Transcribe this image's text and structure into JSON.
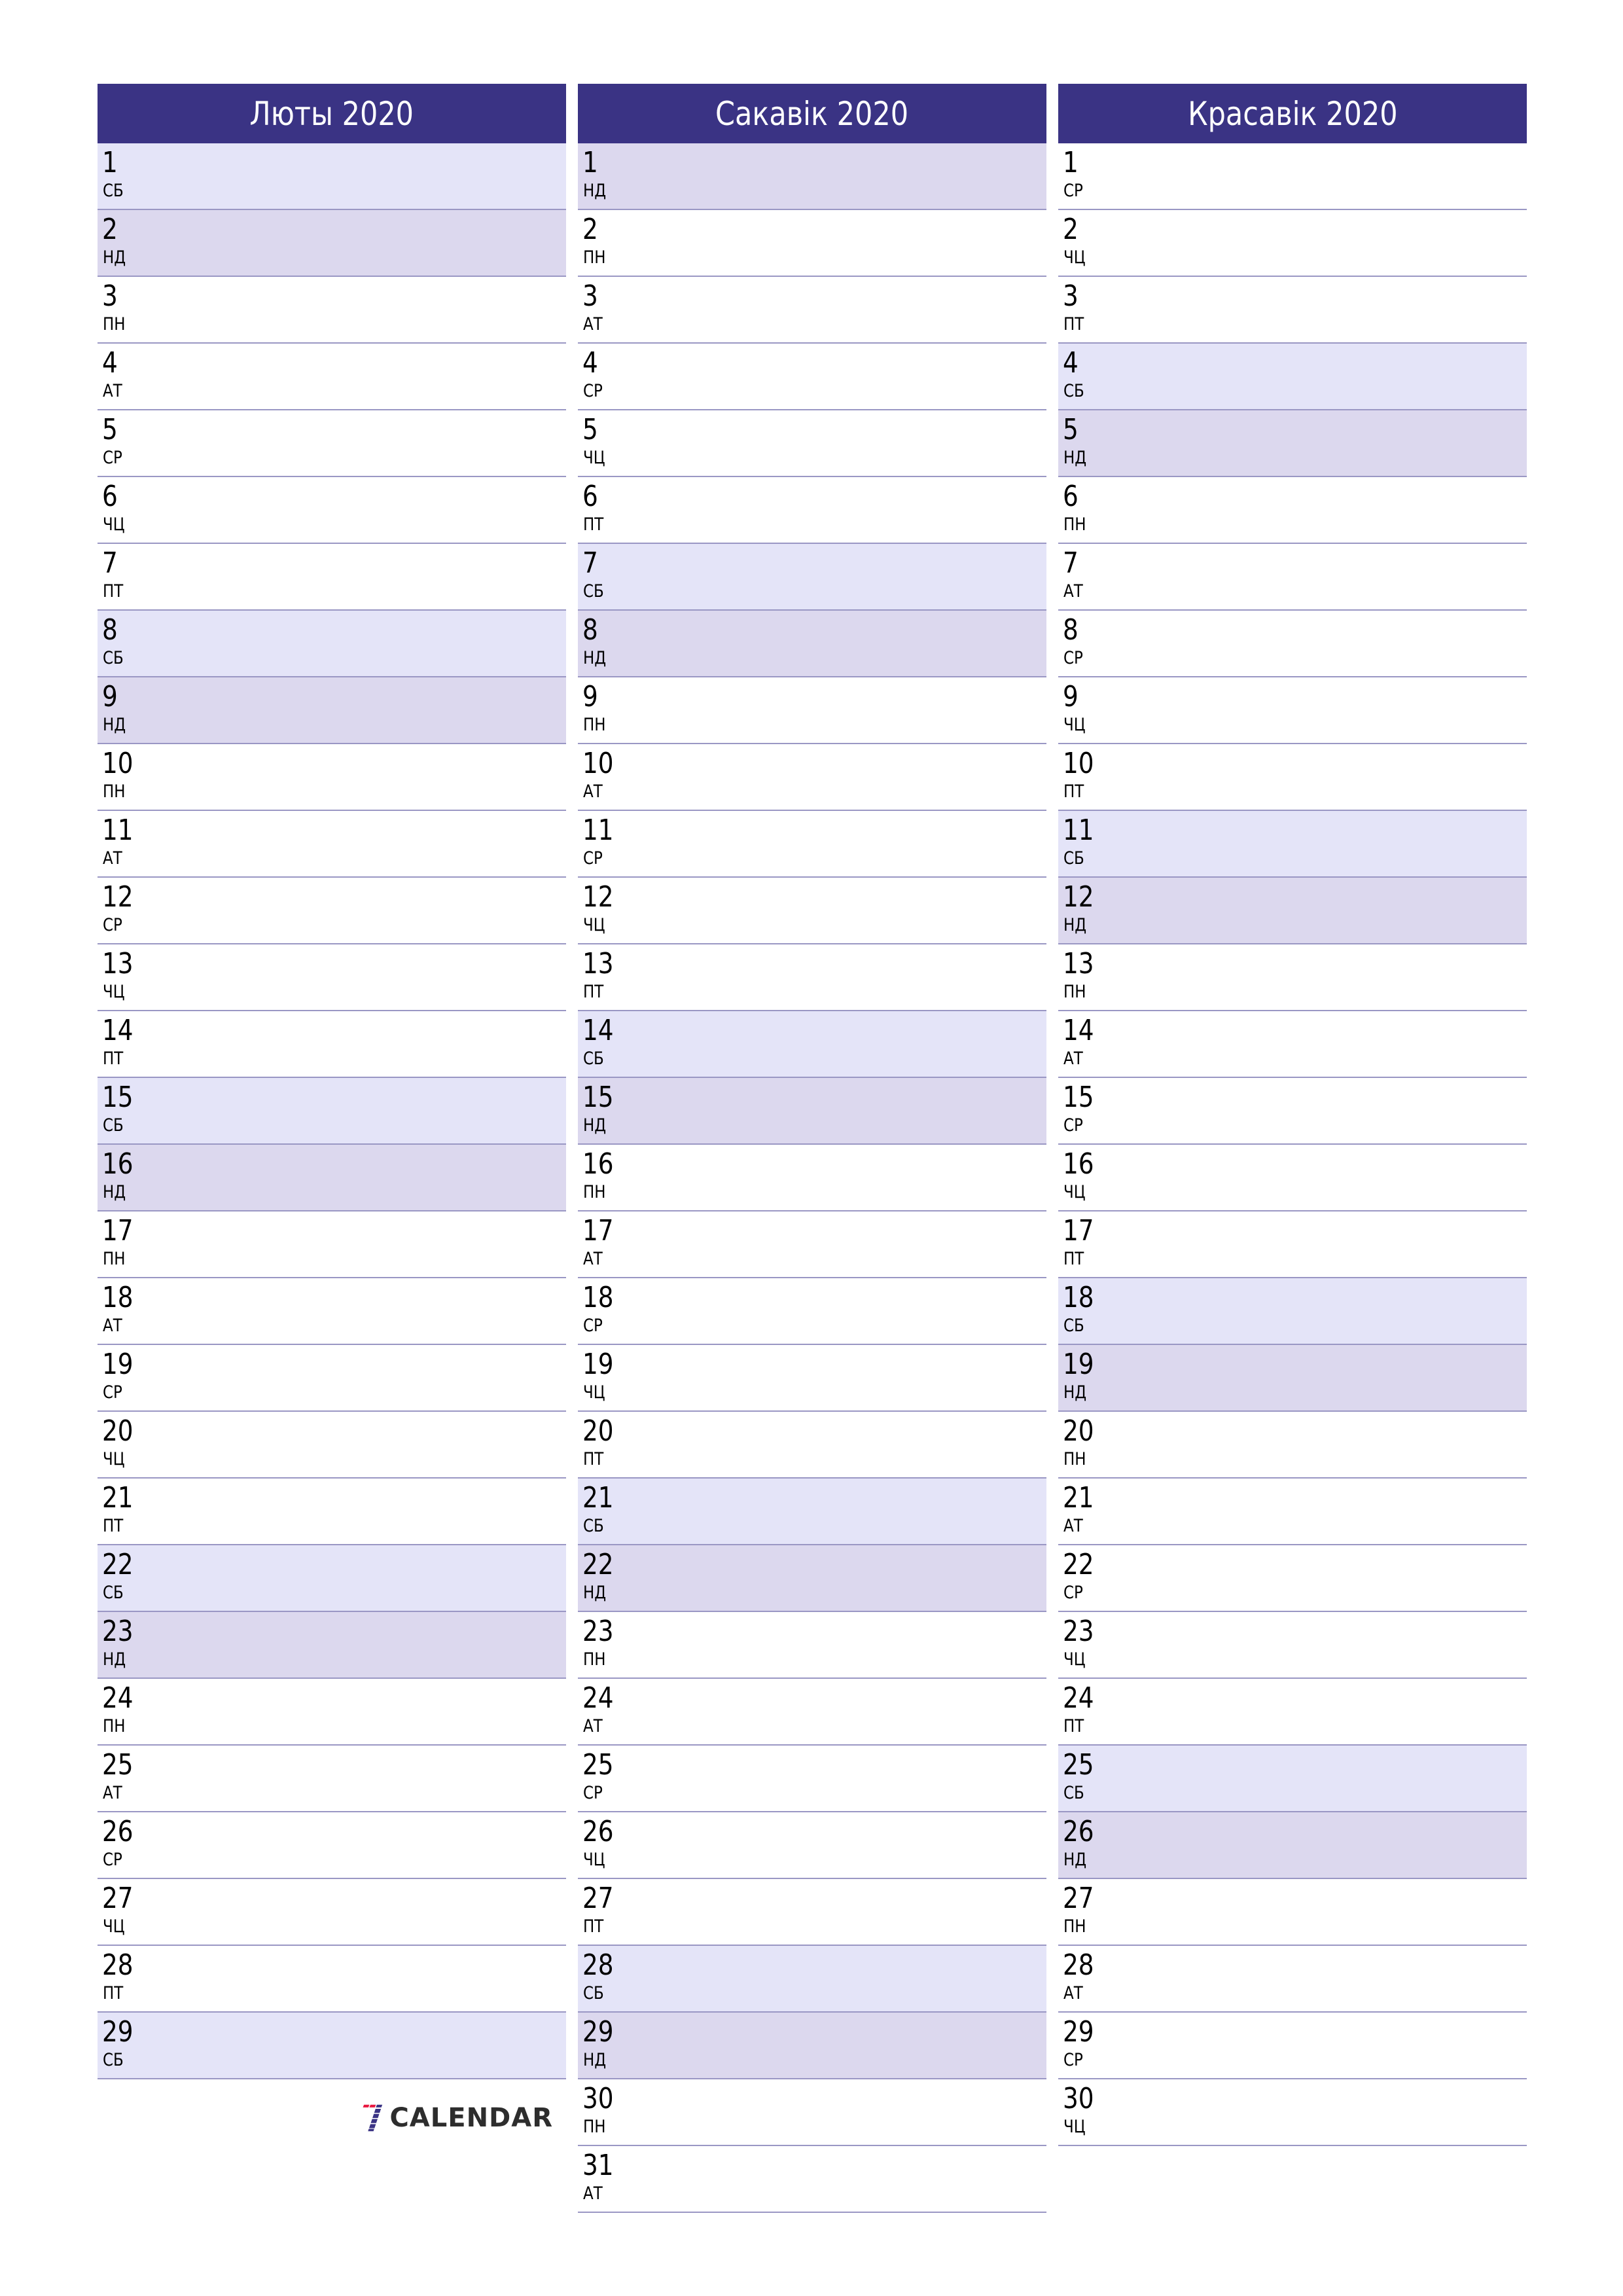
{
  "months": [
    {
      "title": "Люты 2020",
      "days": [
        {
          "d": "1",
          "w": "СБ",
          "t": "sat"
        },
        {
          "d": "2",
          "w": "НД",
          "t": "sun"
        },
        {
          "d": "3",
          "w": "ПН",
          "t": ""
        },
        {
          "d": "4",
          "w": "АТ",
          "t": ""
        },
        {
          "d": "5",
          "w": "СР",
          "t": ""
        },
        {
          "d": "6",
          "w": "ЧЦ",
          "t": ""
        },
        {
          "d": "7",
          "w": "ПТ",
          "t": ""
        },
        {
          "d": "8",
          "w": "СБ",
          "t": "sat"
        },
        {
          "d": "9",
          "w": "НД",
          "t": "sun"
        },
        {
          "d": "10",
          "w": "ПН",
          "t": ""
        },
        {
          "d": "11",
          "w": "АТ",
          "t": ""
        },
        {
          "d": "12",
          "w": "СР",
          "t": ""
        },
        {
          "d": "13",
          "w": "ЧЦ",
          "t": ""
        },
        {
          "d": "14",
          "w": "ПТ",
          "t": ""
        },
        {
          "d": "15",
          "w": "СБ",
          "t": "sat"
        },
        {
          "d": "16",
          "w": "НД",
          "t": "sun"
        },
        {
          "d": "17",
          "w": "ПН",
          "t": ""
        },
        {
          "d": "18",
          "w": "АТ",
          "t": ""
        },
        {
          "d": "19",
          "w": "СР",
          "t": ""
        },
        {
          "d": "20",
          "w": "ЧЦ",
          "t": ""
        },
        {
          "d": "21",
          "w": "ПТ",
          "t": ""
        },
        {
          "d": "22",
          "w": "СБ",
          "t": "sat"
        },
        {
          "d": "23",
          "w": "НД",
          "t": "sun"
        },
        {
          "d": "24",
          "w": "ПН",
          "t": ""
        },
        {
          "d": "25",
          "w": "АТ",
          "t": ""
        },
        {
          "d": "26",
          "w": "СР",
          "t": ""
        },
        {
          "d": "27",
          "w": "ЧЦ",
          "t": ""
        },
        {
          "d": "28",
          "w": "ПТ",
          "t": ""
        },
        {
          "d": "29",
          "w": "СБ",
          "t": "sat"
        }
      ]
    },
    {
      "title": "Сакавік 2020",
      "days": [
        {
          "d": "1",
          "w": "НД",
          "t": "sun"
        },
        {
          "d": "2",
          "w": "ПН",
          "t": ""
        },
        {
          "d": "3",
          "w": "АТ",
          "t": ""
        },
        {
          "d": "4",
          "w": "СР",
          "t": ""
        },
        {
          "d": "5",
          "w": "ЧЦ",
          "t": ""
        },
        {
          "d": "6",
          "w": "ПТ",
          "t": ""
        },
        {
          "d": "7",
          "w": "СБ",
          "t": "sat"
        },
        {
          "d": "8",
          "w": "НД",
          "t": "sun"
        },
        {
          "d": "9",
          "w": "ПН",
          "t": ""
        },
        {
          "d": "10",
          "w": "АТ",
          "t": ""
        },
        {
          "d": "11",
          "w": "СР",
          "t": ""
        },
        {
          "d": "12",
          "w": "ЧЦ",
          "t": ""
        },
        {
          "d": "13",
          "w": "ПТ",
          "t": ""
        },
        {
          "d": "14",
          "w": "СБ",
          "t": "sat"
        },
        {
          "d": "15",
          "w": "НД",
          "t": "sun"
        },
        {
          "d": "16",
          "w": "ПН",
          "t": ""
        },
        {
          "d": "17",
          "w": "АТ",
          "t": ""
        },
        {
          "d": "18",
          "w": "СР",
          "t": ""
        },
        {
          "d": "19",
          "w": "ЧЦ",
          "t": ""
        },
        {
          "d": "20",
          "w": "ПТ",
          "t": ""
        },
        {
          "d": "21",
          "w": "СБ",
          "t": "sat"
        },
        {
          "d": "22",
          "w": "НД",
          "t": "sun"
        },
        {
          "d": "23",
          "w": "ПН",
          "t": ""
        },
        {
          "d": "24",
          "w": "АТ",
          "t": ""
        },
        {
          "d": "25",
          "w": "СР",
          "t": ""
        },
        {
          "d": "26",
          "w": "ЧЦ",
          "t": ""
        },
        {
          "d": "27",
          "w": "ПТ",
          "t": ""
        },
        {
          "d": "28",
          "w": "СБ",
          "t": "sat"
        },
        {
          "d": "29",
          "w": "НД",
          "t": "sun"
        },
        {
          "d": "30",
          "w": "ПН",
          "t": ""
        },
        {
          "d": "31",
          "w": "АТ",
          "t": ""
        }
      ]
    },
    {
      "title": "Красавік 2020",
      "days": [
        {
          "d": "1",
          "w": "СР",
          "t": ""
        },
        {
          "d": "2",
          "w": "ЧЦ",
          "t": ""
        },
        {
          "d": "3",
          "w": "ПТ",
          "t": ""
        },
        {
          "d": "4",
          "w": "СБ",
          "t": "sat"
        },
        {
          "d": "5",
          "w": "НД",
          "t": "sun"
        },
        {
          "d": "6",
          "w": "ПН",
          "t": ""
        },
        {
          "d": "7",
          "w": "АТ",
          "t": ""
        },
        {
          "d": "8",
          "w": "СР",
          "t": ""
        },
        {
          "d": "9",
          "w": "ЧЦ",
          "t": ""
        },
        {
          "d": "10",
          "w": "ПТ",
          "t": ""
        },
        {
          "d": "11",
          "w": "СБ",
          "t": "sat"
        },
        {
          "d": "12",
          "w": "НД",
          "t": "sun"
        },
        {
          "d": "13",
          "w": "ПН",
          "t": ""
        },
        {
          "d": "14",
          "w": "АТ",
          "t": ""
        },
        {
          "d": "15",
          "w": "СР",
          "t": ""
        },
        {
          "d": "16",
          "w": "ЧЦ",
          "t": ""
        },
        {
          "d": "17",
          "w": "ПТ",
          "t": ""
        },
        {
          "d": "18",
          "w": "СБ",
          "t": "sat"
        },
        {
          "d": "19",
          "w": "НД",
          "t": "sun"
        },
        {
          "d": "20",
          "w": "ПН",
          "t": ""
        },
        {
          "d": "21",
          "w": "АТ",
          "t": ""
        },
        {
          "d": "22",
          "w": "СР",
          "t": ""
        },
        {
          "d": "23",
          "w": "ЧЦ",
          "t": ""
        },
        {
          "d": "24",
          "w": "ПТ",
          "t": ""
        },
        {
          "d": "25",
          "w": "СБ",
          "t": "sat"
        },
        {
          "d": "26",
          "w": "НД",
          "t": "sun"
        },
        {
          "d": "27",
          "w": "ПН",
          "t": ""
        },
        {
          "d": "28",
          "w": "АТ",
          "t": ""
        },
        {
          "d": "29",
          "w": "СР",
          "t": ""
        },
        {
          "d": "30",
          "w": "ЧЦ",
          "t": ""
        }
      ]
    }
  ],
  "logo": {
    "text": "CALENDAR",
    "icon": "seven-logo-icon"
  },
  "colors": {
    "header": "#3a3384",
    "saturday": "#e4e4f8",
    "sunday": "#dcd8ee",
    "divider": "#9a97c4",
    "logo_red": "#e8173f",
    "logo_blue": "#3a3384"
  }
}
